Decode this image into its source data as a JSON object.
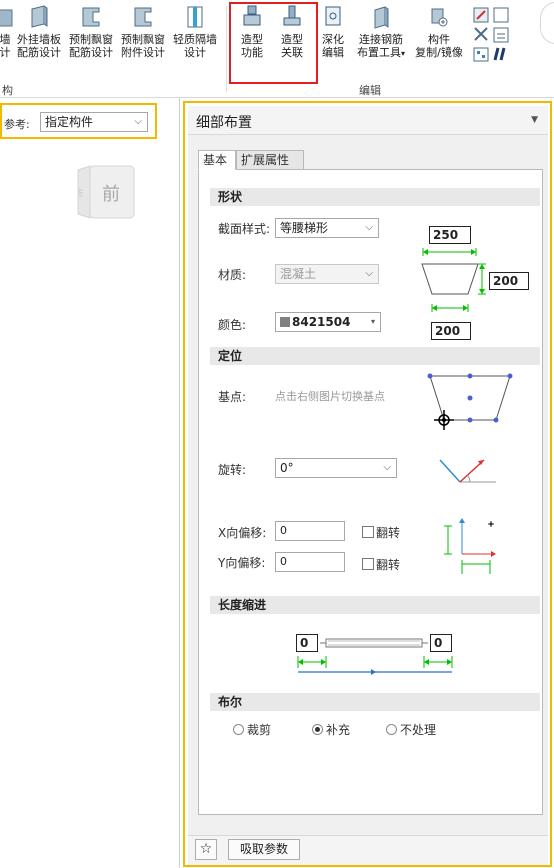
{
  "ribbon": {
    "buttons": [
      {
        "label1": "墙",
        "label2": "计"
      },
      {
        "label1": "外挂墙板",
        "label2": "配筋设计"
      },
      {
        "label1": "预制飘窗",
        "label2": "配筋设计"
      },
      {
        "label1": "预制飘窗",
        "label2": "附件设计"
      },
      {
        "label1": "轻质隔墙",
        "label2": "设计"
      },
      {
        "label1": "造型",
        "label2": "功能"
      },
      {
        "label1": "造型",
        "label2": "关联"
      },
      {
        "label1": "深化",
        "label2": "编辑"
      },
      {
        "label1": "连接钢筋",
        "label2": "布置工具"
      },
      {
        "label1": "构件",
        "label2": "复制/镜像"
      }
    ],
    "group_left": "构",
    "group_right": "编辑"
  },
  "left": {
    "ref_label": "参考:",
    "ref_value": "指定构件",
    "cube_label": "前",
    "cube_side": "左"
  },
  "panel": {
    "title": "细部布置",
    "tabs": [
      "基本",
      "扩展属性"
    ],
    "sections": {
      "shape": "形状",
      "position": "定位",
      "length": "长度缩进",
      "bool": "布尔"
    },
    "shape": {
      "section_label": "截面样式:",
      "section_value": "等腰梯形",
      "material_label": "材质:",
      "material_value": "混凝土",
      "color_label": "颜色:",
      "color_value": "8421504",
      "color_hex": "#808080",
      "top_width": "250",
      "height": "200",
      "bottom_width": "200"
    },
    "position": {
      "base_label": "基点:",
      "base_hint": "点击右侧图片切换基点",
      "rotate_label": "旋转:",
      "rotate_value": "0°",
      "x_offset_label": "X向偏移:",
      "x_offset_value": "0",
      "y_offset_label": "Y向偏移:",
      "y_offset_value": "0",
      "flip_label": "翻转"
    },
    "length": {
      "start": "0",
      "end": "0"
    },
    "bool": {
      "options": [
        "裁剪",
        "补充",
        "不处理"
      ],
      "selected": "补充"
    },
    "footer": {
      "pick_button": "吸取参数"
    }
  }
}
